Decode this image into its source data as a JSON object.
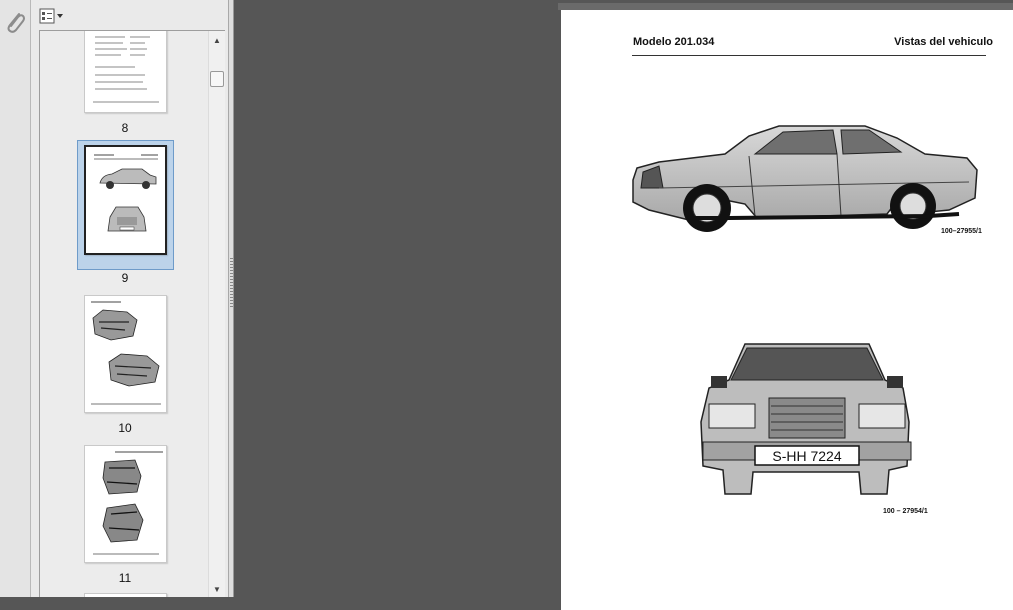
{
  "thumbnails": {
    "pages": [
      {
        "number": "8"
      },
      {
        "number": "9",
        "selected": true
      },
      {
        "number": "10"
      },
      {
        "number": "11"
      }
    ]
  },
  "page": {
    "header_left": "Modelo 201.034",
    "header_right": "Vistas del vehiculo",
    "caption_side": "100–27955/1",
    "caption_front": "100 – 27954/1",
    "plate": "S-HH 7224"
  },
  "colors": {
    "workspace": "#565656",
    "panel": "#eaeaea",
    "selection": "#bcd3ea"
  }
}
